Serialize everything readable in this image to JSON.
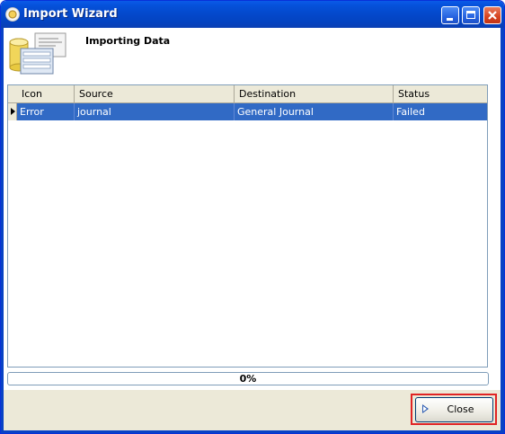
{
  "window": {
    "title": "Import Wizard"
  },
  "header": {
    "heading": "Importing Data"
  },
  "grid": {
    "columns": [
      "Icon",
      "Source",
      "Destination",
      "Status"
    ],
    "rows": [
      {
        "icon": "Error",
        "source": "journal",
        "destination": "General Journal",
        "status": "Failed",
        "selected": true
      }
    ]
  },
  "progress": {
    "text": "0%",
    "value": 0
  },
  "footer": {
    "close_label": "Close"
  },
  "colors": {
    "titlebar": "#0447c9",
    "selection": "#316ac5",
    "highlight_border": "#e02424"
  }
}
